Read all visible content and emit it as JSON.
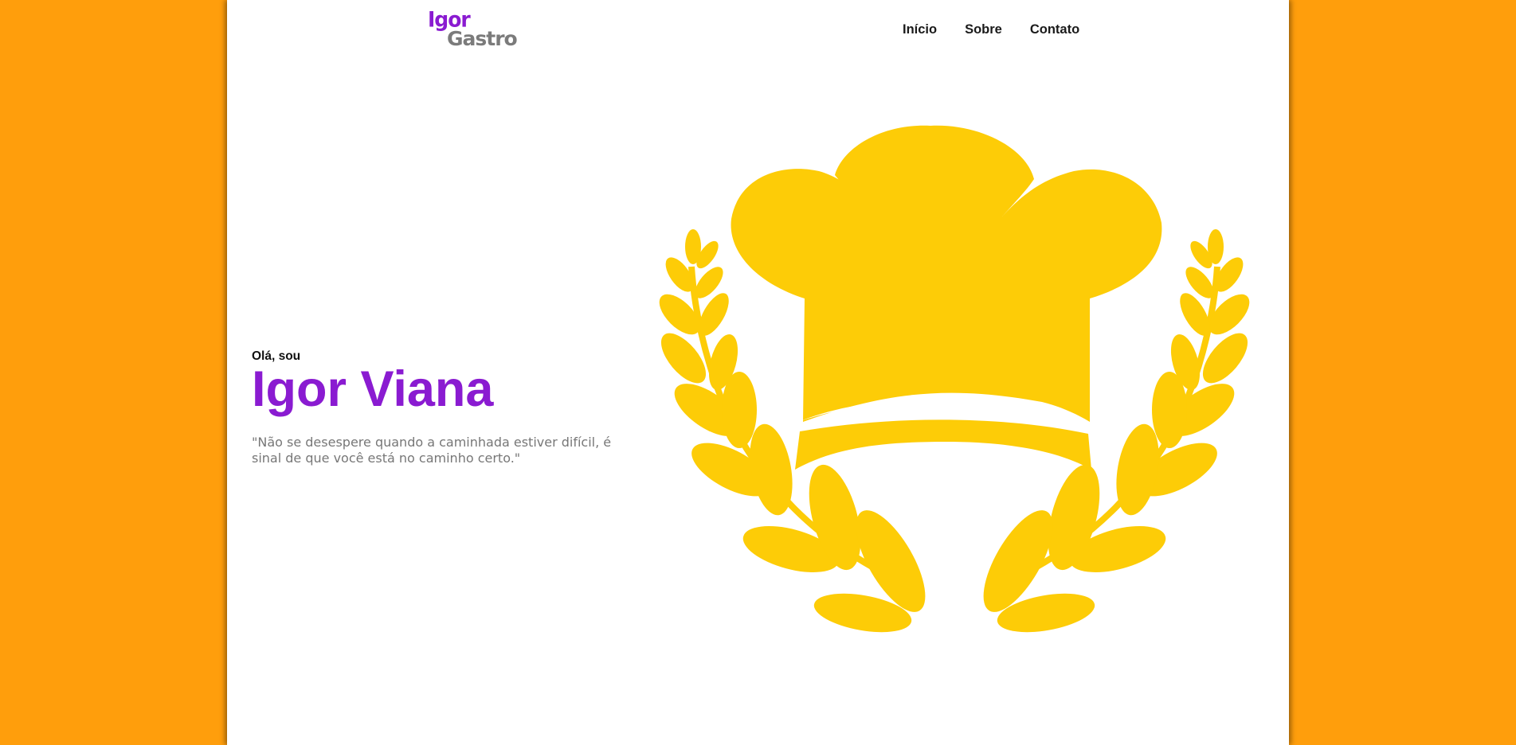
{
  "header": {
    "logo_line1": "Igor",
    "logo_line2": "Gastro",
    "nav": [
      {
        "label": "Início"
      },
      {
        "label": "Sobre"
      },
      {
        "label": "Contato"
      }
    ]
  },
  "hero": {
    "greeting": "Olá, sou",
    "name": "Igor Viana",
    "quote": "\"Não se desespere quando a caminhada estiver difícil, é sinal de que você está no caminho certo.\""
  },
  "illustration": {
    "icon": "chef-hat-with-laurel-icon",
    "color": "#fdcc07"
  },
  "colors": {
    "background": "#ff9e0c",
    "accent": "#8a1bd1",
    "logo_gray": "#7b7b7b"
  }
}
